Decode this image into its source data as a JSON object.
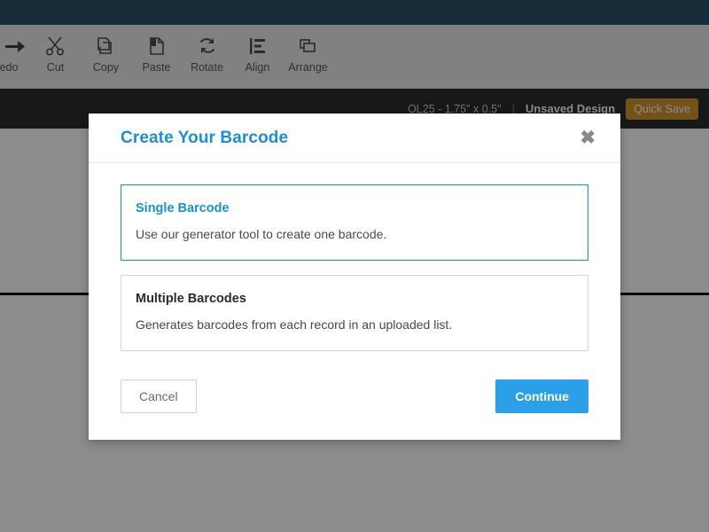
{
  "app": {
    "toolbar": {
      "items": [
        {
          "label": "edo",
          "icon": "redo-arrow-icon",
          "clipped": true
        },
        {
          "label": "Cut",
          "icon": "scissors-icon",
          "clipped": false
        },
        {
          "label": "Copy",
          "icon": "copy-pages-icon",
          "clipped": false
        },
        {
          "label": "Paste",
          "icon": "paste-clipboard-icon",
          "clipped": false
        },
        {
          "label": "Rotate",
          "icon": "rotate-refresh-icon",
          "clipped": false
        },
        {
          "label": "Align",
          "icon": "align-left-lines-icon",
          "clipped": false
        },
        {
          "label": "Arrange",
          "icon": "arrange-stacked-squares-icon",
          "clipped": false
        }
      ]
    },
    "statusbar": {
      "dimensions": "OL25 - 1.75\" x 0.5\"",
      "separator": "|",
      "design_name": "Unsaved Design",
      "quick_save_label": "Quick Save",
      "quick_save_color": "#d2942f"
    }
  },
  "modal": {
    "title": "Create Your Barcode",
    "close_label": "✖",
    "accent_color": "#1b8fd4",
    "options": [
      {
        "title": "Single Barcode",
        "description": "Use our generator tool to create one barcode.",
        "selected": true
      },
      {
        "title": "Multiple Barcodes",
        "description": "Generates barcodes from each record in an uploaded list.",
        "selected": false
      }
    ],
    "footer": {
      "cancel_label": "Cancel",
      "continue_label": "Continue",
      "continue_color": "#2ba0e8"
    }
  }
}
